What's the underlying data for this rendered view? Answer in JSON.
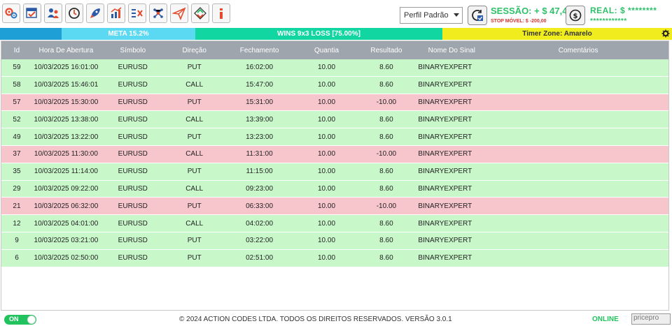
{
  "toolbar": {
    "icons": [
      "settings-gears-icon",
      "calendar-check-icon",
      "users-icon",
      "history-clock-icon",
      "rocket-icon",
      "chart-up-icon",
      "list-x-icon",
      "network-nodes-icon",
      "paper-plane-icon",
      "diamond-arrows-icon",
      "info-icon"
    ],
    "profile_select": "Perfil Padrão",
    "session_label": "SESSÃO: + $ 47,40",
    "stop_label": "STOP MÓVEL: $ -200,00",
    "real_label": "REAL: $ ********",
    "real_sub": "************"
  },
  "statusbar": {
    "meta": "META 15.2%",
    "wins": "WINS 9x3 LOSS [75.00%]",
    "timer": "Timer Zone: Amarelo"
  },
  "table": {
    "headers": {
      "id": "Id",
      "hora": "Hora De Abertura",
      "simbolo": "Símbolo",
      "direcao": "Direção",
      "fechamento": "Fechamento",
      "quantia": "Quantia",
      "resultado": "Resultado",
      "sinal": "Nome Do Sinal",
      "comentarios": "Comentários"
    },
    "rows": [
      {
        "id": "59",
        "hora": "10/03/2025 16:01:00",
        "simbolo": "EURUSD",
        "direcao": "PUT",
        "fechamento": "16:02:00",
        "quantia": "10.00",
        "resultado": "8.60",
        "sinal": "BINARYEXPERT",
        "status": "win"
      },
      {
        "id": "58",
        "hora": "10/03/2025 15:46:01",
        "simbolo": "EURUSD",
        "direcao": "CALL",
        "fechamento": "15:47:00",
        "quantia": "10.00",
        "resultado": "8.60",
        "sinal": "BINARYEXPERT",
        "status": "win"
      },
      {
        "id": "57",
        "hora": "10/03/2025 15:30:00",
        "simbolo": "EURUSD",
        "direcao": "PUT",
        "fechamento": "15:31:00",
        "quantia": "10.00",
        "resultado": "-10.00",
        "sinal": "BINARYEXPERT",
        "status": "loss"
      },
      {
        "id": "52",
        "hora": "10/03/2025 13:38:00",
        "simbolo": "EURUSD",
        "direcao": "CALL",
        "fechamento": "13:39:00",
        "quantia": "10.00",
        "resultado": "8.60",
        "sinal": "BINARYEXPERT",
        "status": "win"
      },
      {
        "id": "49",
        "hora": "10/03/2025 13:22:00",
        "simbolo": "EURUSD",
        "direcao": "PUT",
        "fechamento": "13:23:00",
        "quantia": "10.00",
        "resultado": "8.60",
        "sinal": "BINARYEXPERT",
        "status": "win"
      },
      {
        "id": "37",
        "hora": "10/03/2025 11:30:00",
        "simbolo": "EURUSD",
        "direcao": "CALL",
        "fechamento": "11:31:00",
        "quantia": "10.00",
        "resultado": "-10.00",
        "sinal": "BINARYEXPERT",
        "status": "loss"
      },
      {
        "id": "35",
        "hora": "10/03/2025 11:14:00",
        "simbolo": "EURUSD",
        "direcao": "PUT",
        "fechamento": "11:15:00",
        "quantia": "10.00",
        "resultado": "8.60",
        "sinal": "BINARYEXPERT",
        "status": "win"
      },
      {
        "id": "29",
        "hora": "10/03/2025 09:22:00",
        "simbolo": "EURUSD",
        "direcao": "CALL",
        "fechamento": "09:23:00",
        "quantia": "10.00",
        "resultado": "8.60",
        "sinal": "BINARYEXPERT",
        "status": "win"
      },
      {
        "id": "21",
        "hora": "10/03/2025 06:32:00",
        "simbolo": "EURUSD",
        "direcao": "PUT",
        "fechamento": "06:33:00",
        "quantia": "10.00",
        "resultado": "-10.00",
        "sinal": "BINARYEXPERT",
        "status": "loss"
      },
      {
        "id": "12",
        "hora": "10/03/2025 04:01:00",
        "simbolo": "EURUSD",
        "direcao": "CALL",
        "fechamento": "04:02:00",
        "quantia": "10.00",
        "resultado": "8.60",
        "sinal": "BINARYEXPERT",
        "status": "win"
      },
      {
        "id": "9",
        "hora": "10/03/2025 03:21:00",
        "simbolo": "EURUSD",
        "direcao": "PUT",
        "fechamento": "03:22:00",
        "quantia": "10.00",
        "resultado": "8.60",
        "sinal": "BINARYEXPERT",
        "status": "win"
      },
      {
        "id": "6",
        "hora": "10/03/2025 02:50:00",
        "simbolo": "EURUSD",
        "direcao": "PUT",
        "fechamento": "02:51:00",
        "quantia": "10.00",
        "resultado": "8.60",
        "sinal": "BINARYEXPERT",
        "status": "win"
      }
    ]
  },
  "footer": {
    "toggle": "ON",
    "copyright": "© 2024 ACTION CODES LTDA. TODOS OS DIREITOS RESERVADOS. VERSÃO 3.0.1",
    "status": "ONLINE",
    "brand": "pricepro"
  },
  "colors": {
    "win_row": "#c8f8c9",
    "loss_row": "#f7c6cc",
    "positive": "#2ec16a",
    "negative": "#d6332f"
  }
}
